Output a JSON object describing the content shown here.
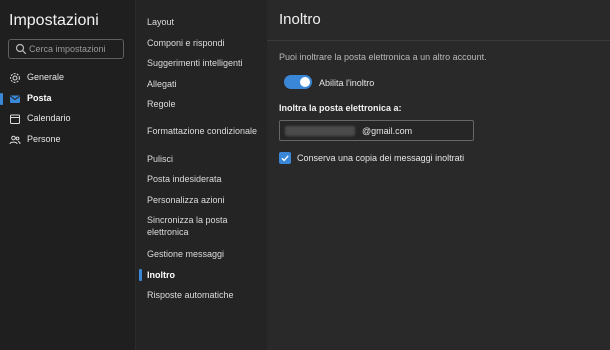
{
  "app": {
    "title": "Impostazioni"
  },
  "search": {
    "placeholder": "Cerca impostazioni"
  },
  "nav": {
    "items": [
      {
        "label": "Generale",
        "icon": "gear-icon"
      },
      {
        "label": "Posta",
        "icon": "mail-icon",
        "active": true
      },
      {
        "label": "Calendario",
        "icon": "calendar-icon"
      },
      {
        "label": "Persone",
        "icon": "people-icon"
      }
    ]
  },
  "submenu": {
    "items": [
      {
        "label": "Layout"
      },
      {
        "label": "Componi e rispondi"
      },
      {
        "label": "Suggerimenti intelligenti"
      },
      {
        "label": "Allegati"
      },
      {
        "label": "Regole"
      },
      {
        "label": "Formattazione condizionale"
      },
      {
        "label": "Pulisci"
      },
      {
        "label": "Posta indesiderata"
      },
      {
        "label": "Personalizza azioni"
      },
      {
        "label": "Sincronizza la posta elettronica"
      },
      {
        "label": "Gestione messaggi"
      },
      {
        "label": "Inoltro",
        "active": true
      },
      {
        "label": "Risposte automatiche"
      }
    ]
  },
  "main": {
    "title": "Inoltro",
    "description": "Puoi inoltrare la posta elettronica a un altro account.",
    "toggle": {
      "label": "Abilita l'inoltro",
      "on": true
    },
    "forward_field": {
      "label": "Inoltra la posta elettronica a:",
      "value_visible": "@gmail.com"
    },
    "keep_copy": {
      "label": "Conserva una copia dei messaggi inoltrati",
      "checked": true
    }
  },
  "colors": {
    "accent": "#3a87d8",
    "bg_left": "#1f1f1f",
    "bg_mid": "#242424",
    "bg_right": "#292929"
  }
}
